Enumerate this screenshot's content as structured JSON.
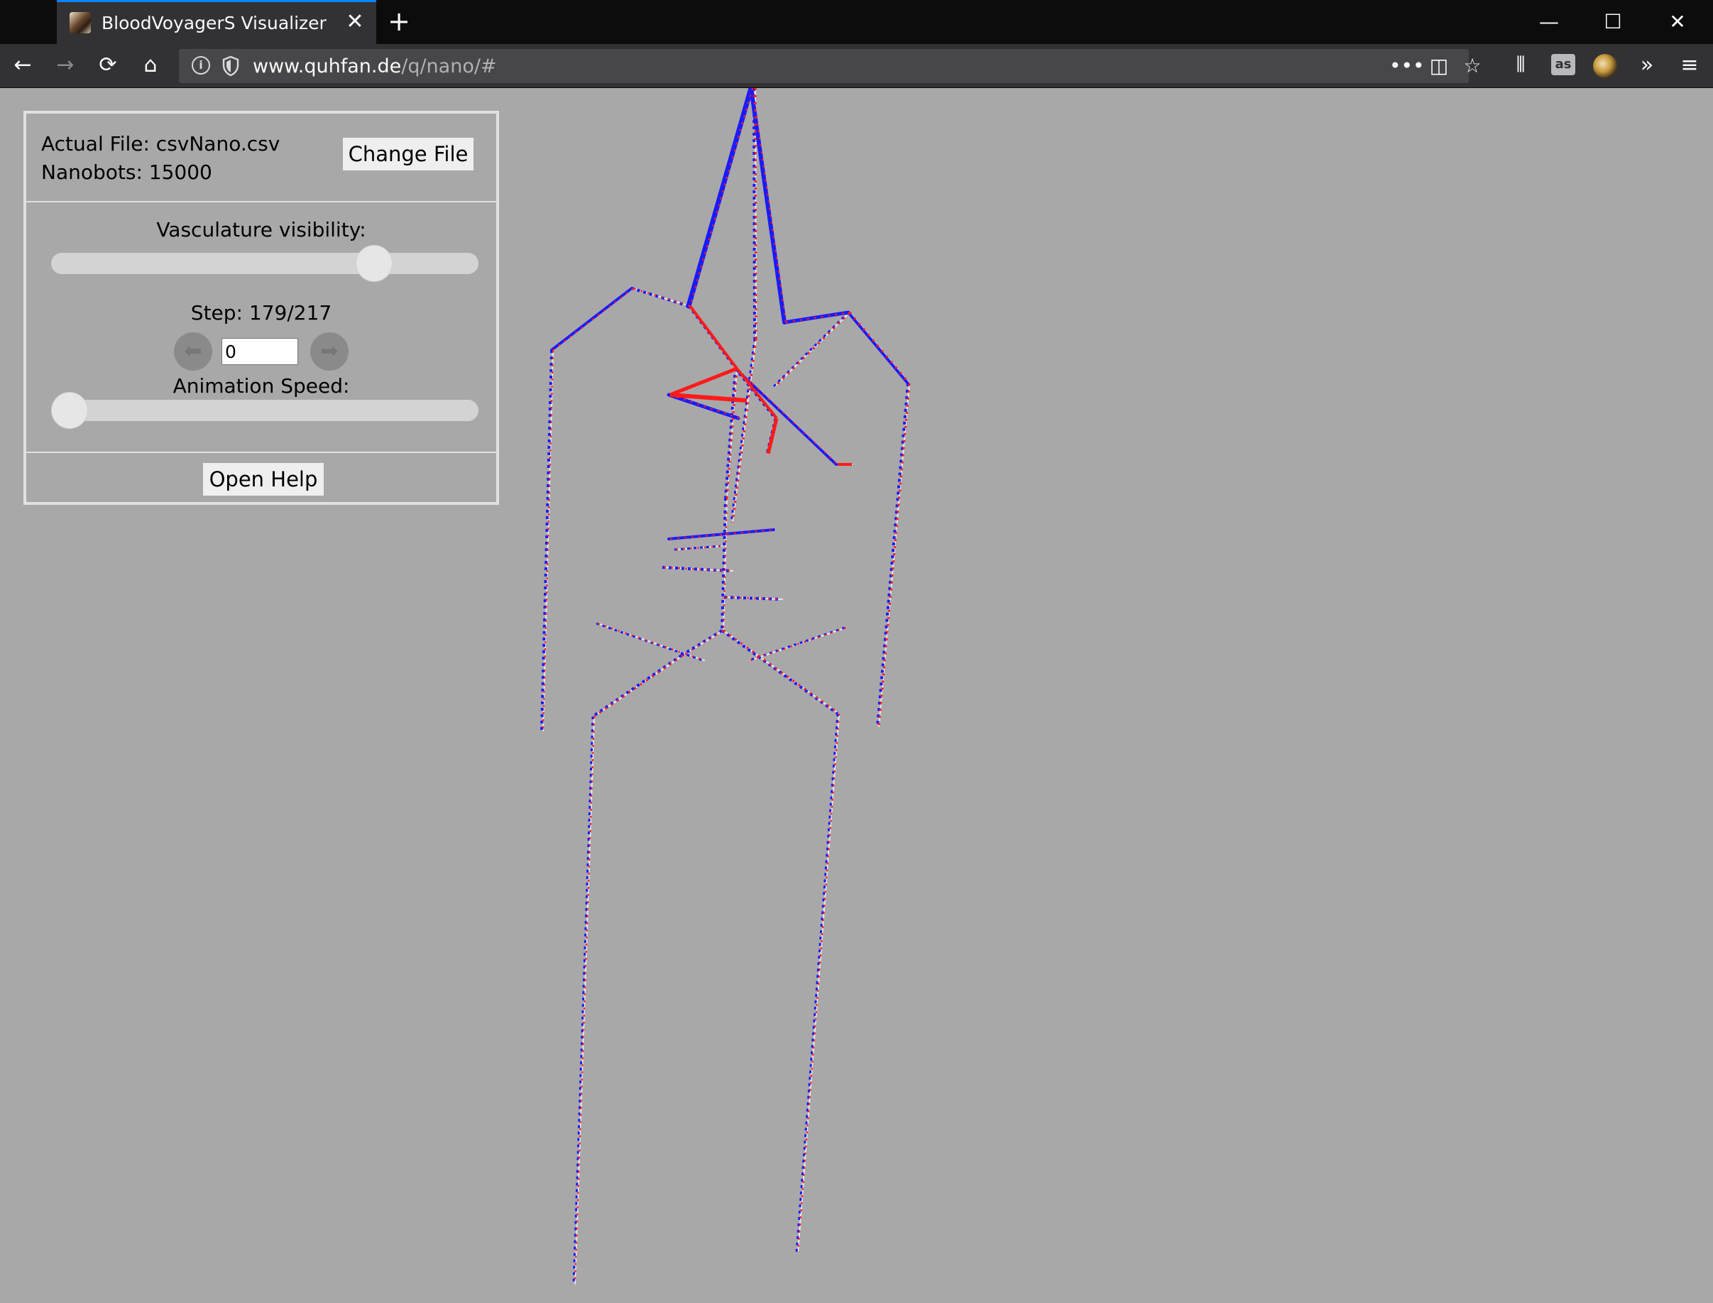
{
  "browser": {
    "tab_title": "BloodVoyagerS Visualizer",
    "tab_close": "✕",
    "new_tab": "+",
    "url_host": "www.quhfan.de",
    "url_path": "/q/nano/#",
    "window": {
      "minimize": "—",
      "maximize": "☐",
      "close": "✕"
    },
    "nav": {
      "back": "←",
      "forward": "→",
      "reload": "⟳",
      "home": "⌂"
    },
    "url_actions": {
      "more": "•••",
      "pocket": "◫",
      "bookmark": "☆"
    },
    "toolbar": {
      "library": "⫴",
      "lastfm": "as",
      "overflow": "»",
      "menu": "≡"
    },
    "icons": [
      "info-icon",
      "shield-icon",
      "more-icon",
      "pocket-icon",
      "star-icon",
      "library-icon",
      "lastfm-icon",
      "avatar-icon",
      "overflow-icon",
      "hamburger-icon"
    ]
  },
  "panel": {
    "file_label": "Actual File: csvNano.csv",
    "nanobots_label": "Nanobots: 15000",
    "change_file_button": "Change File",
    "visibility_label": "Vasculature visibility:",
    "visibility_value": 0.78,
    "step_label": "Step: 179/217",
    "step_input_value": "0",
    "prev_arrow": "⬅",
    "next_arrow": "➡",
    "speed_label": "Animation Speed:",
    "speed_value": 0.0,
    "help_button": "Open Help"
  },
  "scene": {
    "colors": {
      "background": "#a8a8a8",
      "vessel": "#e8e8e8",
      "nanobot_blue": "#1a1aff",
      "nanobot_red": "#ff1a1a"
    }
  }
}
